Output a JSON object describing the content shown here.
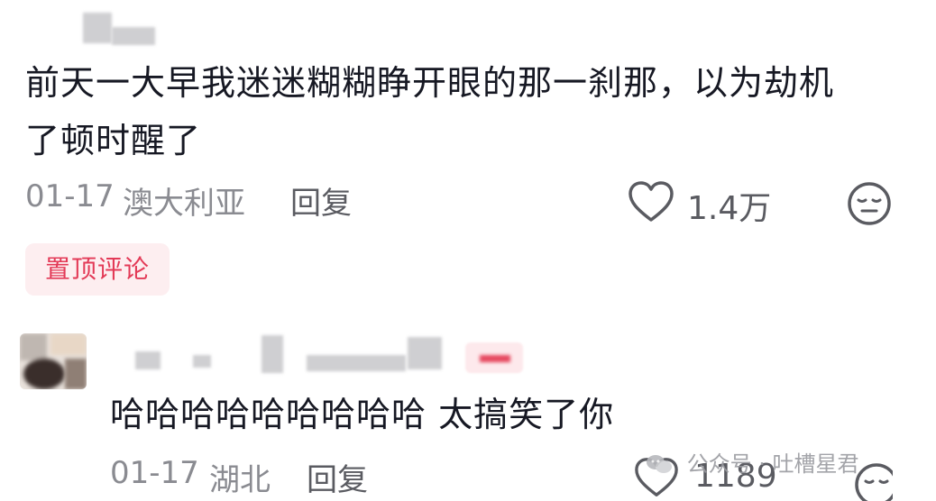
{
  "comment1": {
    "text_line1": "前天一大早我迷迷糊糊睁开眼的那一刹那，以为劫机",
    "text_line2": "了顿时醒了",
    "date": "01-17",
    "location": "澳大利亚",
    "reply_label": "回复",
    "like_count": "1.4万",
    "pinned_label": "置顶评论"
  },
  "comment2": {
    "text": "哈哈哈哈哈哈哈哈哈 太搞笑了你",
    "date": "01-17",
    "location": "湖北",
    "reply_label": "回复",
    "like_count": "1189"
  },
  "watermark": {
    "text": "公众号 · 吐槽星君"
  },
  "icons": {
    "like": "heart-outline-icon",
    "dislike": "neutral-face-icon",
    "watermark_logo": "wechat-logo-icon"
  },
  "colors": {
    "text": "#161823",
    "meta": "#8a8b91",
    "pin_bg": "#fdeef0",
    "pin_fg": "#e33a57"
  }
}
